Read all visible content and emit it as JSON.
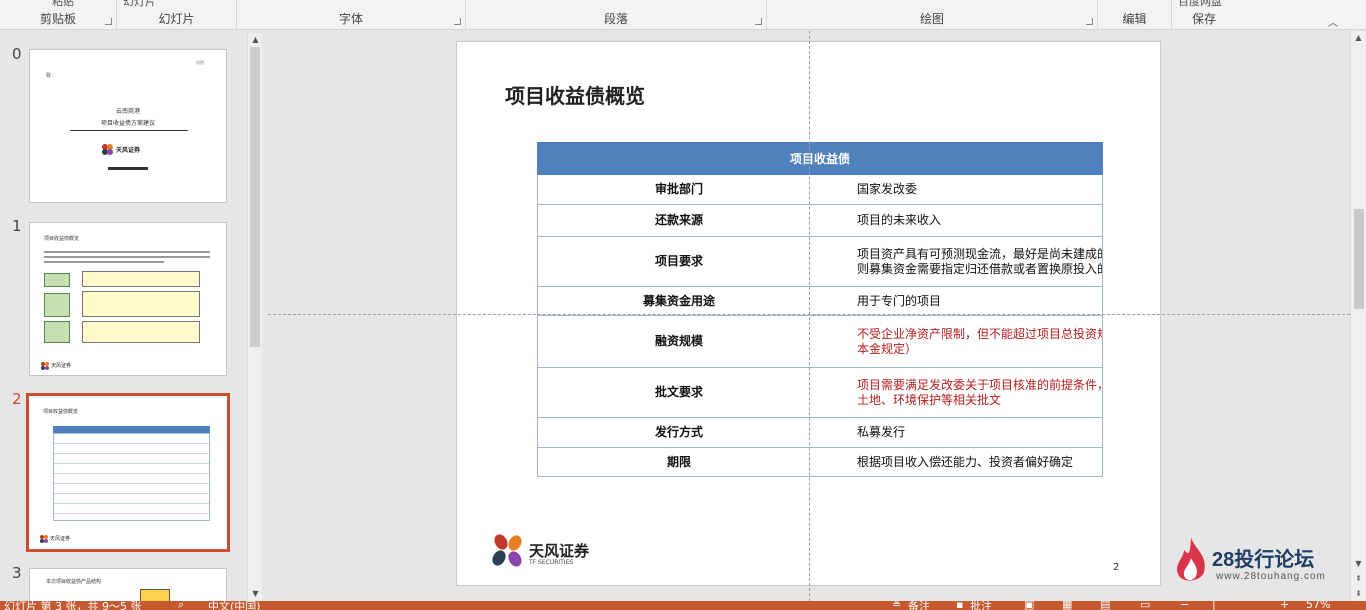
{
  "ribbon": {
    "groups": [
      {
        "label": "剪贴板",
        "top_text": "粘贴"
      },
      {
        "label": "幻灯片",
        "top_text": "幻灯片"
      },
      {
        "label": "字体"
      },
      {
        "label": "段落"
      },
      {
        "label": "绘图"
      },
      {
        "label": "编辑"
      },
      {
        "label": "保存",
        "top_text": "百度网盘"
      }
    ]
  },
  "thumbnails": [
    {
      "num": "0",
      "title": "云南商港",
      "subtitle": "项目收益债方案建议",
      "brand": "天风证券"
    },
    {
      "num": "1",
      "title": "项目收益债概览",
      "brand": "天风证券"
    },
    {
      "num": "2",
      "title": "项目收益债概览",
      "brand": "天风证券"
    },
    {
      "num": "3",
      "title": "本次项目收益债产品结构"
    }
  ],
  "slide": {
    "title": "项目收益债概览",
    "table_header": "项目收益债",
    "rows": [
      {
        "key": "审批部门",
        "value": "国家发改委"
      },
      {
        "key": "还款来源",
        "value": "项目的未来收入"
      },
      {
        "key": "项目要求",
        "value_line1": "项目资产具有可预测现金流，最好是尚未建成的项目；如果是已建成的项目，",
        "value_line2": "则募集资金需要指定归还借款或者置换原投入的自有资金"
      },
      {
        "key": "募集资金用途",
        "value": "用于专门的项目"
      },
      {
        "key": "融资规模",
        "value_line1": "不受企业净资产限制，但不能超过项目总投资规模的一定比例（满足最低资",
        "value_line2": "本金规定）"
      },
      {
        "key": "批文要求",
        "value_line1": "项目需要满足发改委关于项目核准的前提条件， 有投资、节能评估、规划、",
        "value_line2": "土地、环境保护等相关批文"
      },
      {
        "key": "发行方式",
        "value": "私募发行"
      },
      {
        "key": "期限",
        "value": "根据项目收入偿还能力、投资者偏好确定"
      }
    ],
    "logo_text": "天风证券",
    "logo_sub": "TF SECURITIES",
    "page_number": "2"
  },
  "watermark": {
    "title": "28投行论坛",
    "url": "www.28touhang.com"
  },
  "status": {
    "slide_info": "幻灯片 第 3 张，共 9～5 张",
    "language": "中文(中国)",
    "notes": "备注",
    "comments": "批注",
    "zoom": "57%"
  },
  "colors": {
    "accent": "#c8502f",
    "table_header": "#4f81bd",
    "red_text": "#b41e1e",
    "status_bar": "#c55a30"
  }
}
